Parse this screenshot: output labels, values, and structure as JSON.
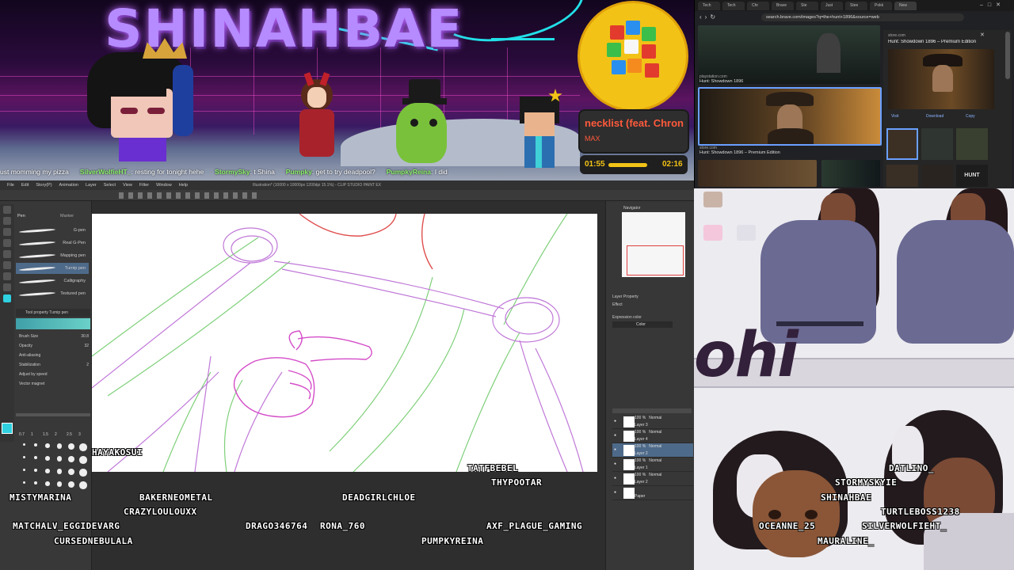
{
  "banner": {
    "channel_title": "SHINAHBAE",
    "now_playing": {
      "title": "necklist (feat. Chron",
      "artist": "MAX",
      "current_time": "01:55",
      "duration": "02:16",
      "progress": 0.846
    },
    "chat_ticker": [
      {
        "user": "",
        "text": "ust momming my pizza"
      },
      {
        "user": "SilverWolfieHT_",
        "text": "resting for tonight hehe"
      },
      {
        "user": "StormySky",
        "text": "t Shina"
      },
      {
        "user": "Pumpky",
        "text": "get to try deadpool?"
      },
      {
        "user": "PumpkyReina",
        "text": "I did"
      }
    ]
  },
  "browser": {
    "tabs": [
      "Tech",
      "Tech",
      "Chr",
      "Brave",
      "Ste",
      "Just",
      "Stee",
      "Pokk",
      "New"
    ],
    "url": "search.brave.com/images?q=the+hunt+1896&source=web",
    "results": [
      {
        "source": "playstation.com",
        "title": "Hunt: Showdown 1896"
      },
      {
        "source": "store.com",
        "title": "Hunt: Showdown 1896 – Premium Edition"
      }
    ],
    "side_panel": {
      "source": "store.com",
      "title": "Hunt: Showdown 1896 – Premium Edition",
      "buttons": [
        "Visit",
        "Download",
        "Copy"
      ],
      "thumb_label": "HUNT"
    }
  },
  "csp": {
    "title_bar": "Illustration* (10000 x 10000px 1200dpi 15.1%) - CLIP STUDIO PAINT EX",
    "menu": [
      "File",
      "Edit",
      "Story(P)",
      "Animation",
      "Layer",
      "Select",
      "View",
      "Filter",
      "Window",
      "Help"
    ],
    "brush_tabs": [
      "Pen",
      "Marker"
    ],
    "brushes": [
      {
        "name": "G-pen",
        "selected": false
      },
      {
        "name": "Real G-Pen",
        "selected": false
      },
      {
        "name": "Mapping pen",
        "selected": false
      },
      {
        "name": "Turnip pen",
        "selected": true
      },
      {
        "name": "Calligraphy",
        "selected": false
      },
      {
        "name": "Textured pen",
        "selected": false
      }
    ],
    "tool_property": {
      "header": "Tool property  Turnip pen",
      "rows": [
        {
          "label": "Brush Size",
          "value": "30.8"
        },
        {
          "label": "Opacity",
          "value": "32"
        },
        {
          "label": "Anti-aliasing",
          "value": ""
        },
        {
          "label": "Stabilization",
          "value": "2"
        },
        {
          "label": "Adjust by speed",
          "value": ""
        },
        {
          "label": "Vector magnet",
          "value": ""
        }
      ]
    },
    "brush_sizes": [
      "0.7",
      "1",
      "1.5",
      "2",
      "2.5",
      "3"
    ],
    "navigator_label": "Navigator",
    "layer_property": {
      "header": "Layer Property",
      "effect_label": "Effect",
      "expression_label": "Expression color",
      "expression_value": "Color"
    },
    "layers": [
      {
        "opacity": "100 %",
        "blend": "Normal",
        "name": "Layer 3",
        "selected": false
      },
      {
        "opacity": "100 %",
        "blend": "Normal",
        "name": "Layer 4",
        "selected": false
      },
      {
        "opacity": "100 %",
        "blend": "Normal",
        "name": "Layer 2",
        "selected": true
      },
      {
        "opacity": "100 %",
        "blend": "Normal",
        "name": "Layer 1",
        "selected": false
      },
      {
        "opacity": "100 %",
        "blend": "Normal",
        "name": "Layer 2",
        "selected": false
      },
      {
        "opacity": "",
        "blend": "",
        "name": "Paper",
        "selected": false
      }
    ]
  },
  "viewers": [
    "HAYAKOSUI",
    "TATFBEBEL",
    "THYPOOTAR",
    "MISTYMARINA",
    "BAKERNEOMETAL",
    "DEADGIRLCHLOE",
    "CRAZYLOULOUXX",
    "MATCHALV_EGGIDEVARG",
    "DRAGO346764",
    "RONA_760",
    "AXF_PLAGUE_GAMING",
    "CURSEDNEBULALA",
    "PUMPKYREINA",
    "DATLINO_",
    "STORMYSKYIE",
    "SHINAHBAE",
    "TURTLEBOSS1238",
    "OCEANNE_25",
    "SILVERWOLFIEHT_",
    "MAURALINE_"
  ],
  "vcam": {
    "banner_text": "ohi"
  },
  "colors": {
    "banner_title": "#b58bff",
    "neon": "#22e0e8",
    "np_accent": "#ff5a3c",
    "np_bar": "#f2c316",
    "csp_panel": "#383838",
    "csp_selection": "#4e6a8a",
    "hoodie": "#6b6a93"
  }
}
